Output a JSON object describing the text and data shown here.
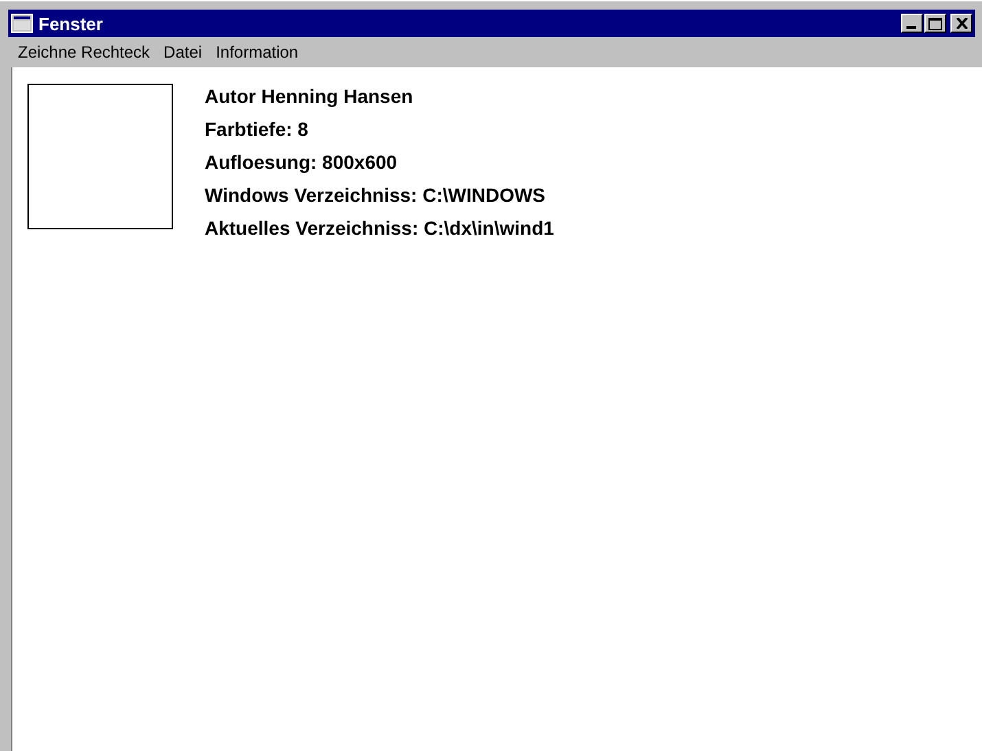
{
  "window": {
    "title": "Fenster"
  },
  "menu": [
    "Zeichne Rechteck",
    "Datei",
    "Information"
  ],
  "info_lines": [
    "Autor Henning Hansen",
    "Farbtiefe: 8",
    "Aufloesung: 800x600",
    "Windows Verzeichniss: C:\\WINDOWS",
    "Aktuelles Verzeichniss: C:\\dx\\in\\wind1"
  ]
}
